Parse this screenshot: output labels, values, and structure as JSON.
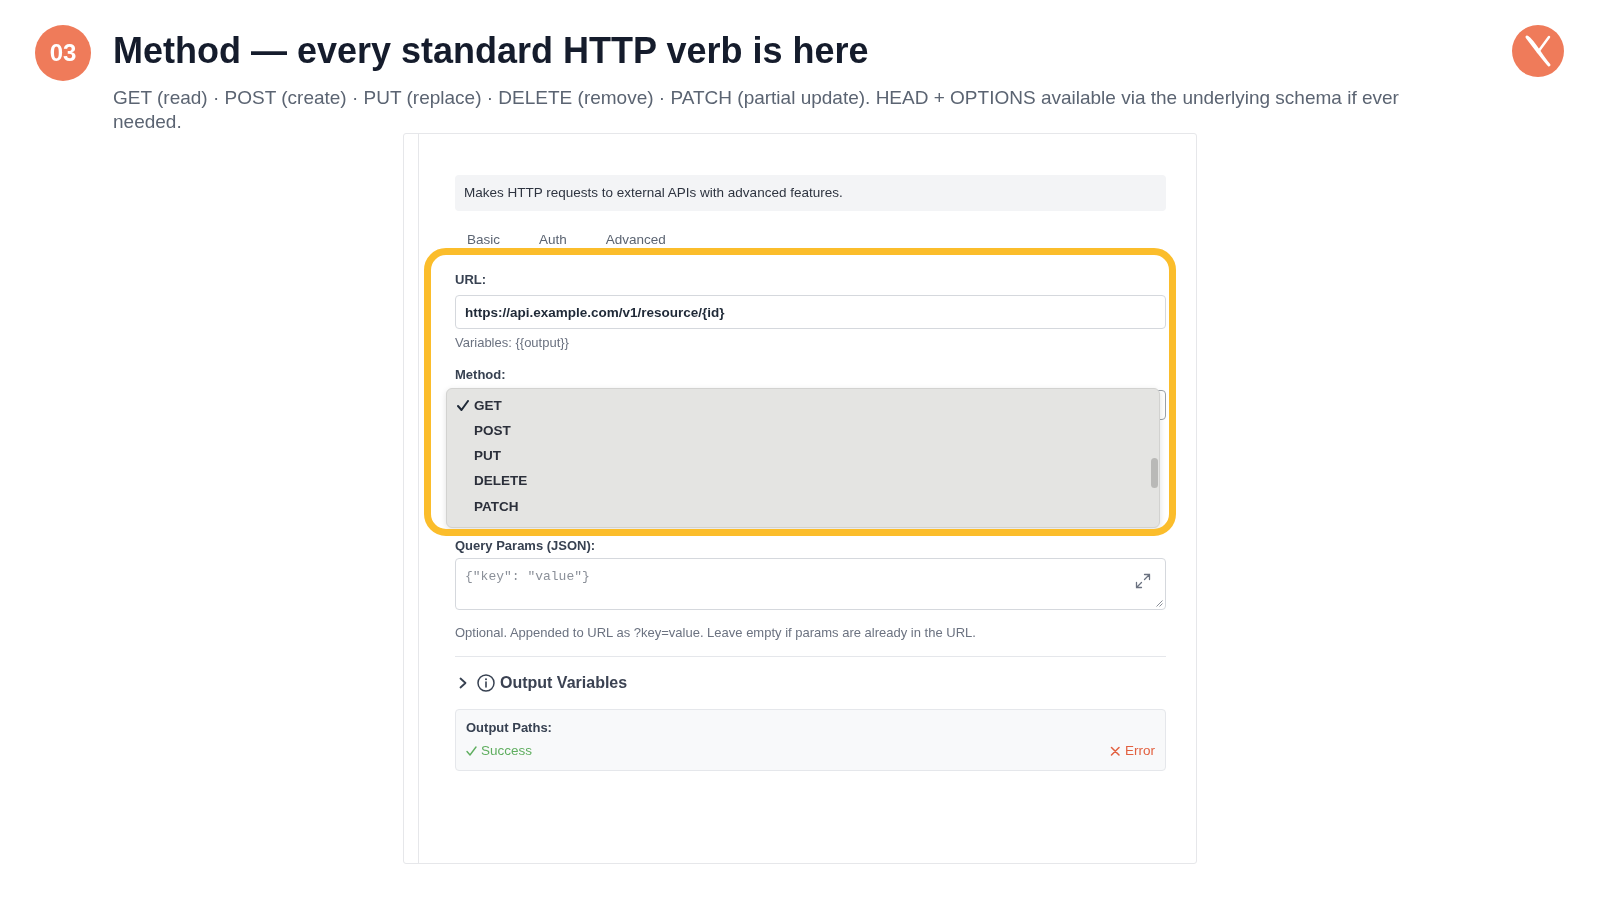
{
  "header": {
    "step": "03",
    "title": "Method — every standard HTTP verb is here",
    "subtitle": "GET (read) · POST (create) · PUT (replace) · DELETE (remove) · PATCH (partial update). HEAD + OPTIONS available via the underlying schema if ever needed."
  },
  "panel": {
    "description": "Makes HTTP requests to external APIs with advanced features.",
    "tabs": [
      {
        "label": "Basic"
      },
      {
        "label": "Auth"
      },
      {
        "label": "Advanced"
      }
    ],
    "url": {
      "label": "URL:",
      "value": "https://api.example.com/v1/resource/{id}",
      "hint": "Variables: {{output}}"
    },
    "method": {
      "label": "Method:",
      "options": [
        {
          "label": "GET",
          "selected": true
        },
        {
          "label": "POST",
          "selected": false
        },
        {
          "label": "PUT",
          "selected": false
        },
        {
          "label": "DELETE",
          "selected": false
        },
        {
          "label": "PATCH",
          "selected": false
        }
      ]
    },
    "query_params": {
      "label": "Query Params (JSON):",
      "placeholder": "{\"key\": \"value\"}",
      "hint": "Optional. Appended to URL as ?key=value. Leave empty if params are already in the URL."
    },
    "output_variables": {
      "title": "Output Variables",
      "expanded": false
    },
    "output_paths": {
      "label": "Output Paths:",
      "paths": [
        {
          "kind": "success",
          "label": "Success"
        },
        {
          "kind": "error",
          "label": "Error"
        }
      ]
    }
  }
}
